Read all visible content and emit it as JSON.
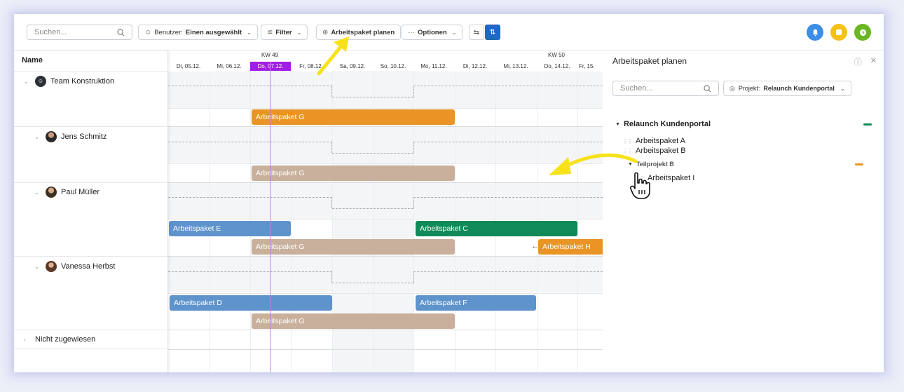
{
  "toolbar": {
    "search_placeholder": "Suchen...",
    "users_label": "Benutzer:",
    "users_value": "Einen ausgewählt",
    "filter_label": "Filter",
    "plan_label": "Arbeitspaket planen",
    "options_label": "Optionen"
  },
  "colors": {
    "accent_purple": "#a21ee3",
    "blue_bar": "#5e93cb",
    "green_bar": "#0f8a58",
    "orange_bar": "#e99424",
    "tan_bar": "#c8b09c",
    "notif_blue": "#3c8ee6",
    "notif_yellow": "#f5c211",
    "notif_green": "#6ab623"
  },
  "timeline": {
    "name_header": "Name",
    "weeks": [
      {
        "label": "KW 49"
      },
      {
        "label": "KW 50"
      }
    ],
    "days": [
      "Di, 05.12.",
      "Mi, 06.12.",
      "Do, 07.12.",
      "Fr, 08.12.",
      "Sa, 09.12.",
      "So, 10.12.",
      "Mo, 11.12.",
      "Di, 12.12.",
      "Mi, 13.12.",
      "Do, 14.12.",
      "Fr, 15."
    ],
    "selected_day_index": 2
  },
  "rows": [
    {
      "label": "Team Konstruktion"
    },
    {
      "label": "Jens Schmitz"
    },
    {
      "label": "Paul Müller"
    },
    {
      "label": "Vanessa Herbst"
    },
    {
      "label": "Nicht zugewiesen"
    }
  ],
  "bars": {
    "g_team": "Arbeitspaket G",
    "g_jens": "Arbeitspaket G",
    "e": "Arbeitspaket E",
    "c": "Arbeitspaket C",
    "g_paul": "Arbeitspaket G",
    "h": "Arbeitspaket H",
    "d": "Arbeitspaket D",
    "f": "Arbeitspaket F",
    "g_vanessa": "Arbeitspaket G"
  },
  "panel": {
    "title": "Arbeitspaket planen",
    "search_placeholder": "Suchen...",
    "project_label": "Projekt:",
    "project_value": "Relaunch Kundenportal",
    "tree": {
      "project": "Relaunch Kundenportal",
      "items": [
        "Arbeitspaket A",
        "Arbeitspaket B"
      ],
      "subproject": "Teilprojekt B",
      "subitems": [
        "Arbeitspaket I"
      ]
    }
  }
}
